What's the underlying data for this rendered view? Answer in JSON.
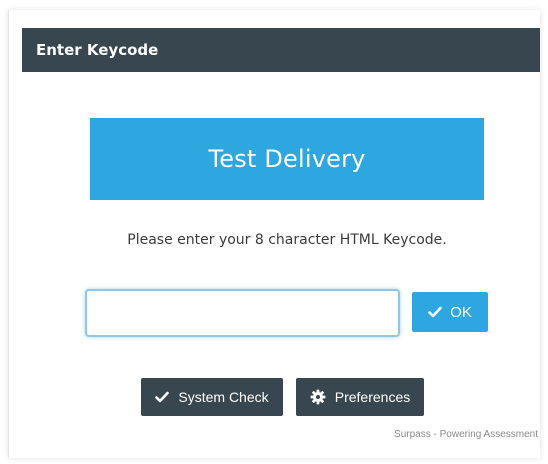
{
  "dialog": {
    "title": "Enter Keycode"
  },
  "banner": {
    "title": "Test Delivery"
  },
  "instruction": "Please enter your 8 character HTML Keycode.",
  "keycode": {
    "value_part1": "",
    "value_part2": ""
  },
  "buttons": {
    "ok_label": "OK",
    "system_check_label": "System Check",
    "preferences_label": "Preferences"
  },
  "footer": {
    "text": "Surpass - Powering Assessment"
  },
  "icons": {
    "ok": "checkmark-icon",
    "system_check": "checkmark-icon",
    "preferences": "gear-icon"
  },
  "colors": {
    "titlebar": "#37464f",
    "accent": "#2ea6e0",
    "dark_button": "#37464f",
    "field_border": "#8fc7ea"
  }
}
